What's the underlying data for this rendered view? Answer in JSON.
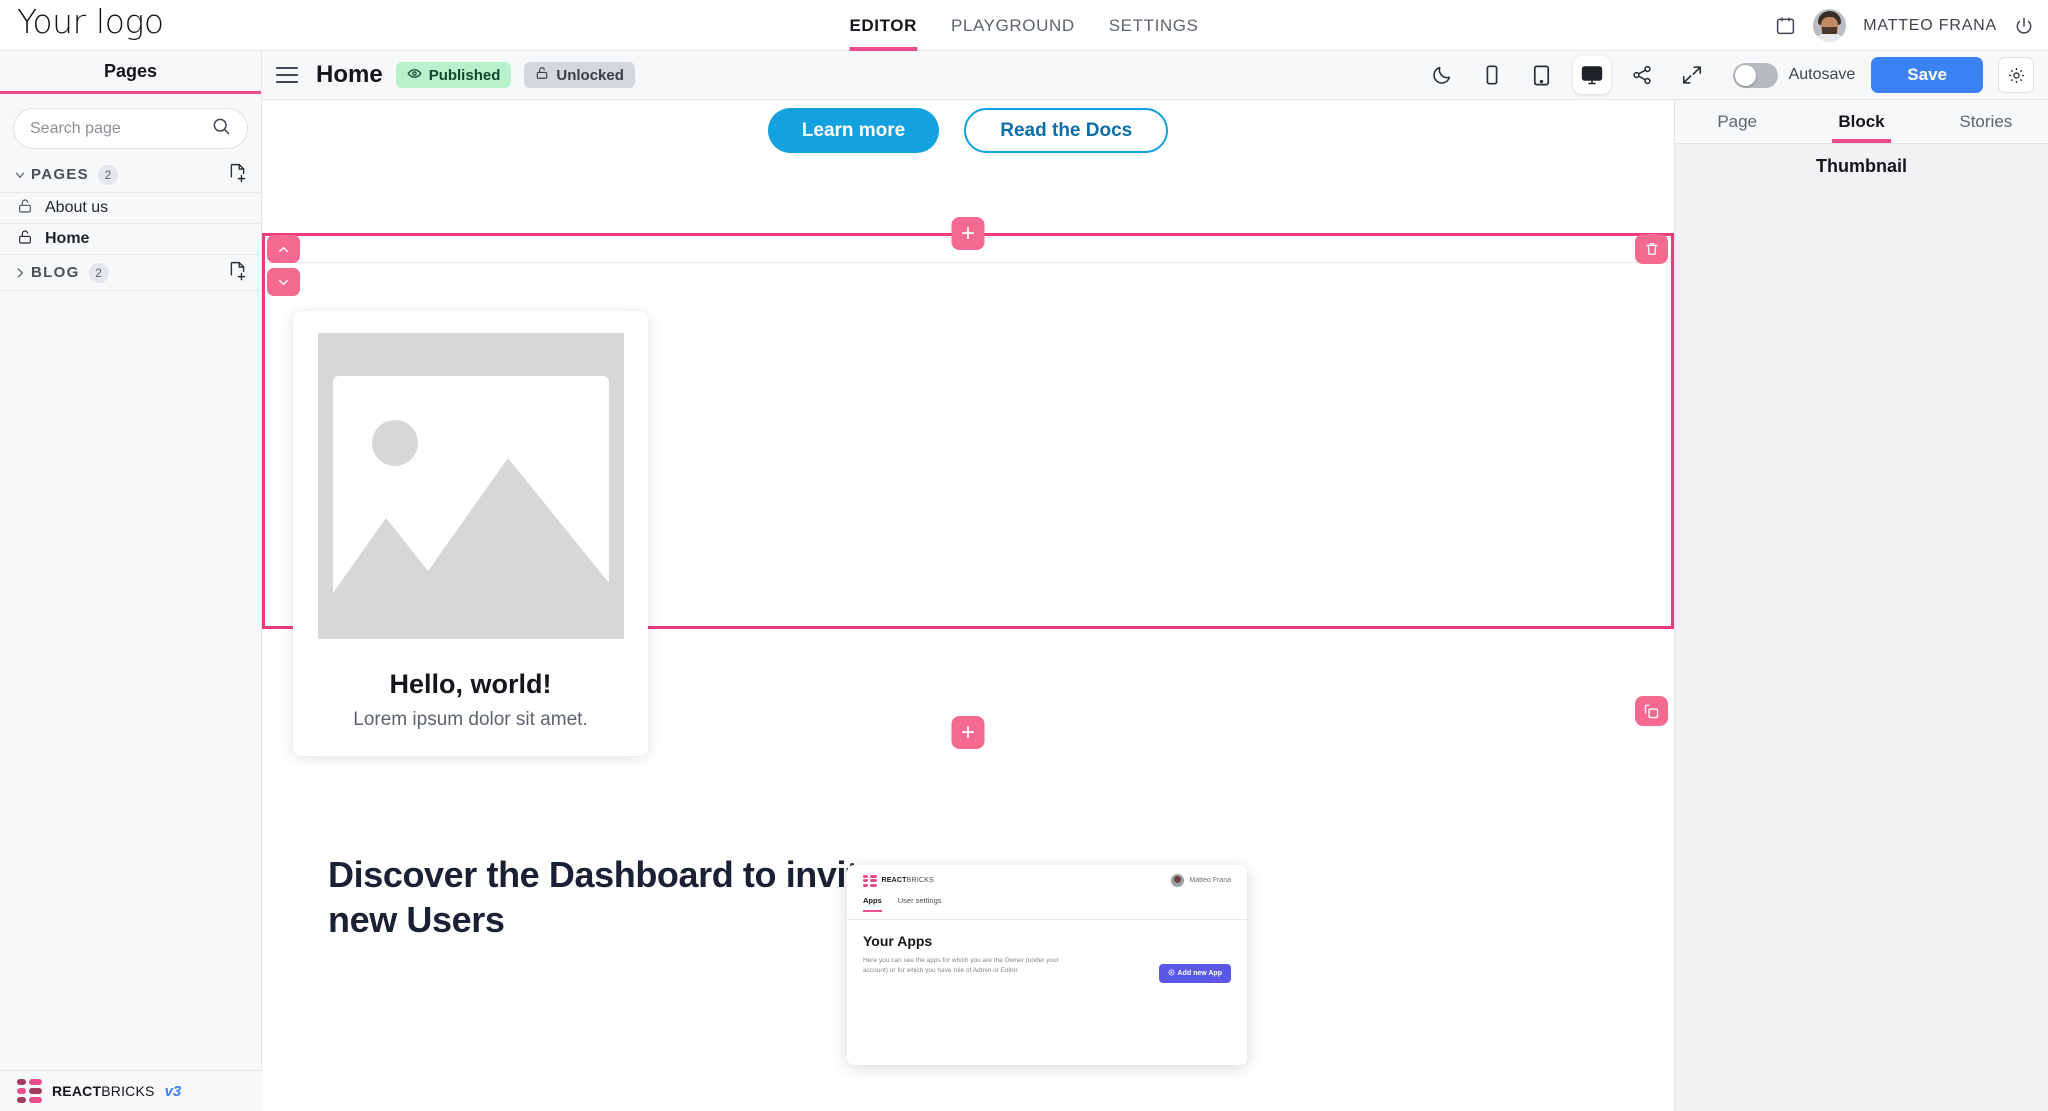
{
  "topbar": {
    "logo": "Your logo",
    "nav": [
      {
        "label": "EDITOR",
        "active": true
      },
      {
        "label": "PLAYGROUND",
        "active": false
      },
      {
        "label": "SETTINGS",
        "active": false
      }
    ],
    "username": "MATTEO FRANA",
    "calendar_icon": "calendar-icon",
    "power_icon": "power-icon"
  },
  "sidebar": {
    "title": "Pages",
    "search": {
      "placeholder": "Search page",
      "value": ""
    },
    "groups": [
      {
        "label": "PAGES",
        "count": "2",
        "expanded": true
      },
      {
        "label": "BLOG",
        "count": "2",
        "expanded": false
      }
    ],
    "pages": [
      {
        "label": "About us",
        "active": false,
        "lock": "unlocked"
      },
      {
        "label": "Home",
        "active": true,
        "lock": "unlocked"
      }
    ],
    "footer": {
      "brand_bold": "REACT",
      "brand_light": "BRICKS",
      "version": "v3"
    }
  },
  "editor_header": {
    "page_name": "Home",
    "published_label": "Published",
    "unlocked_label": "Unlocked",
    "tools": [
      {
        "name": "dark-mode",
        "icon": "moon-icon",
        "selected": false
      },
      {
        "name": "mobile-preview",
        "icon": "phone-icon",
        "selected": false
      },
      {
        "name": "tablet-preview",
        "icon": "tablet-icon",
        "selected": false
      },
      {
        "name": "desktop-preview",
        "icon": "desktop-icon",
        "selected": true
      },
      {
        "name": "share",
        "icon": "share-icon",
        "selected": false
      },
      {
        "name": "fullscreen",
        "icon": "expand-icon",
        "selected": false
      }
    ],
    "autosave_label": "Autosave",
    "autosave_on": false,
    "save_label": "Save",
    "settings_icon": "gear-icon"
  },
  "right_panel": {
    "tabs": [
      {
        "label": "Page",
        "active": false
      },
      {
        "label": "Block",
        "active": true
      },
      {
        "label": "Stories",
        "active": false
      }
    ],
    "section_title": "Thumbnail"
  },
  "canvas": {
    "hero_buttons": [
      {
        "label": "Learn more",
        "style": "filled"
      },
      {
        "label": "Read the Docs",
        "style": "outline"
      }
    ],
    "selected_block": {
      "add_label": "+",
      "move_up_icon": "chevron-up-icon",
      "move_down_icon": "chevron-down-icon",
      "delete_icon": "trash-icon",
      "duplicate_icon": "copy-icon",
      "card": {
        "image": "image-placeholder",
        "title": "Hello, world!",
        "subtitle": "Lorem ipsum dolor sit amet."
      }
    },
    "section_two": {
      "title": "Discover the Dashboard to invite new Users",
      "dashboard_mock": {
        "brand_bold": "REACT",
        "brand_light": "BRICKS",
        "user": "Matteo Frana",
        "tabs": [
          {
            "label": "Apps",
            "active": true
          },
          {
            "label": "User settings",
            "active": false
          }
        ],
        "heading": "Your Apps",
        "paragraph": "Here you can see the apps for which you are the Owner (under your account) or for which you have role of Admin or Editor.",
        "cta": "Add new App"
      }
    }
  },
  "colors": {
    "accent_pink": "#ec4d8d",
    "primary_blue": "#3b82f6",
    "published_green": "#b7f2cd",
    "cyan": "#14a1e0"
  }
}
